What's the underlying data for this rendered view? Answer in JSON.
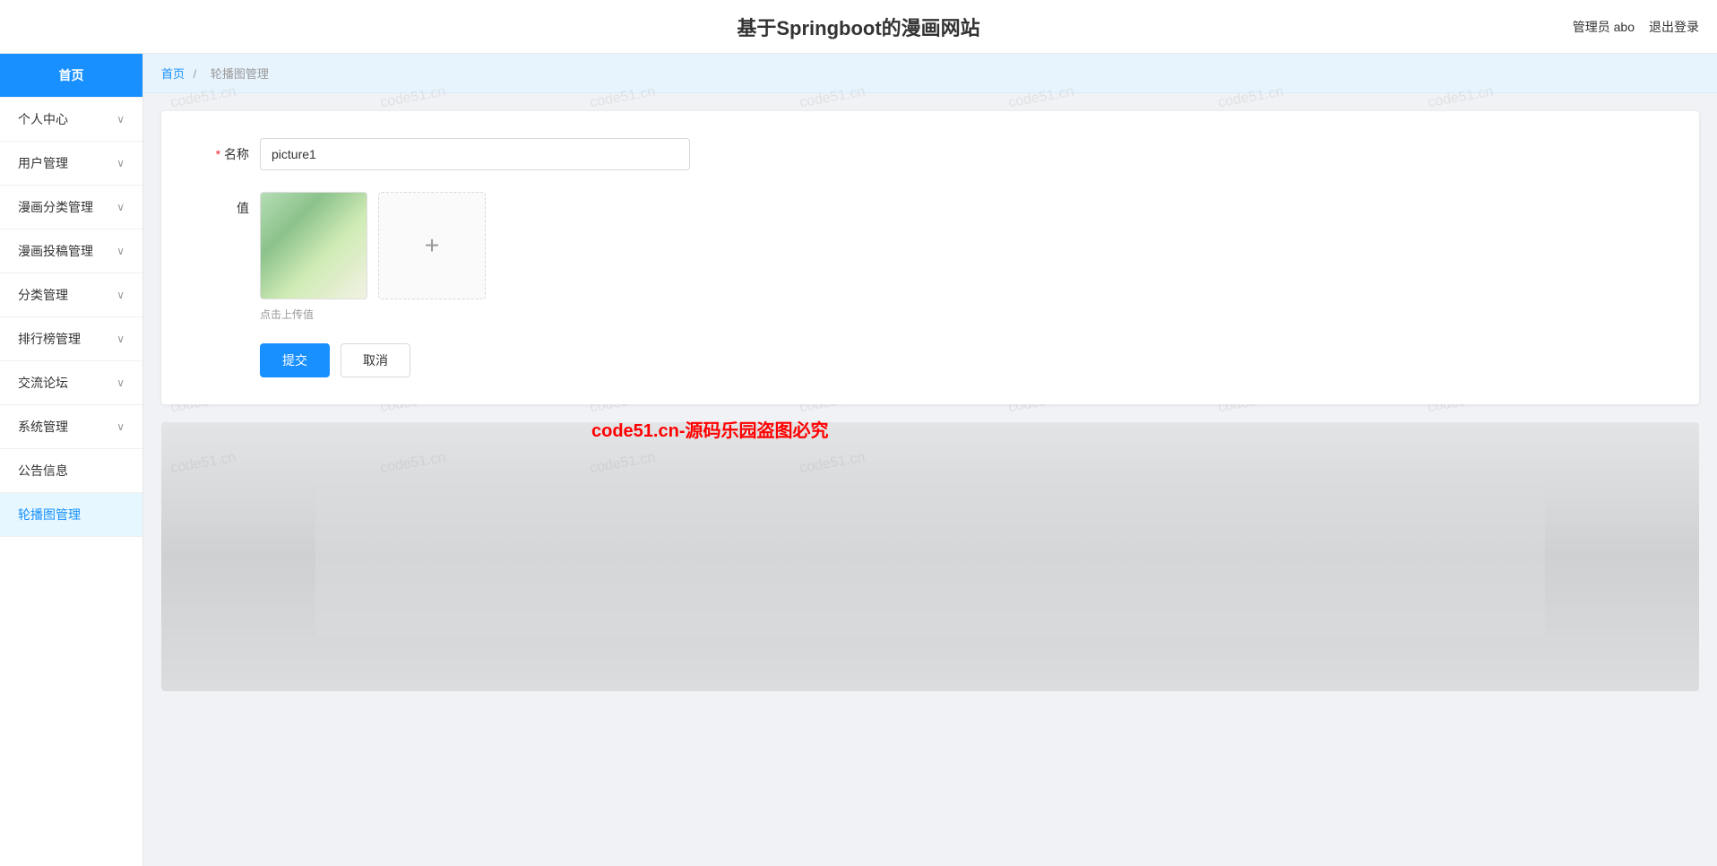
{
  "header": {
    "title": "基于Springboot的漫画网站",
    "admin_label": "管理员 abo",
    "logout_label": "退出登录"
  },
  "sidebar": {
    "items": [
      {
        "label": "首页",
        "type": "home",
        "has_arrow": false
      },
      {
        "label": "个人中心",
        "type": "menu",
        "has_arrow": true
      },
      {
        "label": "用户管理",
        "type": "menu",
        "has_arrow": true
      },
      {
        "label": "漫画分类管理",
        "type": "menu",
        "has_arrow": true
      },
      {
        "label": "漫画投稿管理",
        "type": "menu",
        "has_arrow": true
      },
      {
        "label": "分类管理",
        "type": "menu",
        "has_arrow": true
      },
      {
        "label": "排行榜管理",
        "type": "menu",
        "has_arrow": true
      },
      {
        "label": "交流论坛",
        "type": "menu",
        "has_arrow": true
      },
      {
        "label": "系统管理",
        "type": "menu",
        "has_arrow": true
      },
      {
        "label": "公告信息",
        "type": "item",
        "has_arrow": false
      },
      {
        "label": "轮播图管理",
        "type": "item",
        "has_arrow": false,
        "active": true
      }
    ]
  },
  "breadcrumb": {
    "home_label": "首页",
    "separator": "/",
    "current_label": "轮播图管理"
  },
  "form": {
    "name_label": "名称",
    "name_value": "picture1",
    "name_placeholder": "",
    "value_label": "值",
    "upload_hint": "点击上传值",
    "submit_label": "提交",
    "cancel_label": "取消",
    "upload_plus": "+"
  },
  "watermark": {
    "text": "code51.cn"
  },
  "copyright": {
    "text": "code51.cn-源码乐园盗图必究"
  }
}
